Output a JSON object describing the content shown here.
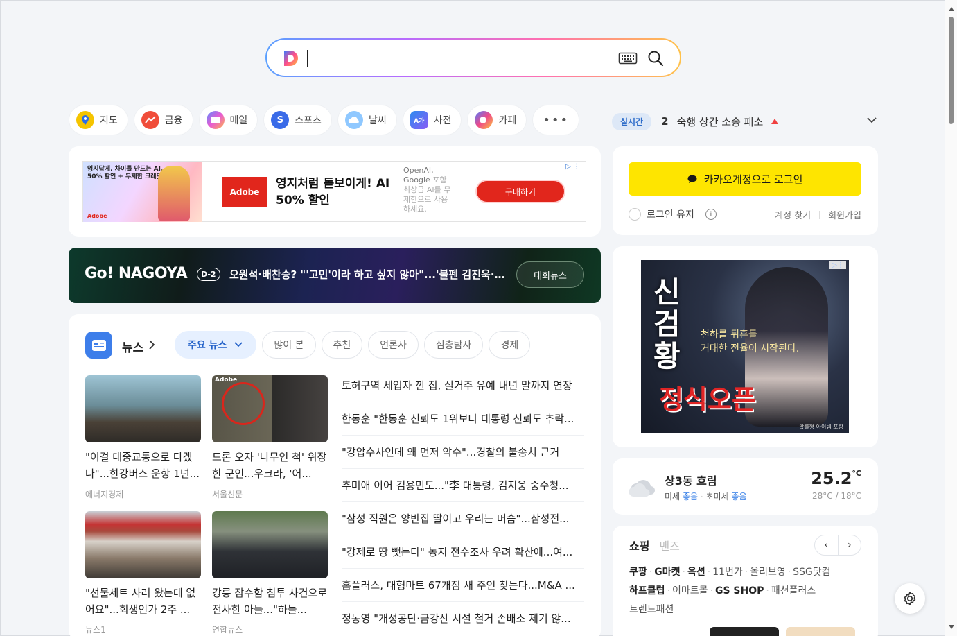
{
  "search": {
    "placeholder": ""
  },
  "shortcuts": [
    {
      "label": "지도",
      "icon": "map-pin-icon",
      "color": "#f5c400"
    },
    {
      "label": "금융",
      "icon": "finance-chart-icon",
      "color": "#f04d3a"
    },
    {
      "label": "메일",
      "icon": "mail-icon",
      "color": "#8a5cf5"
    },
    {
      "label": "스포츠",
      "icon": "sports-icon",
      "color": "#3a6be8"
    },
    {
      "label": "날씨",
      "icon": "weather-icon",
      "color": "#3aa0f0"
    },
    {
      "label": "사전",
      "icon": "dictionary-icon",
      "color": "#2d8bf0"
    },
    {
      "label": "카페",
      "icon": "cafe-icon",
      "color": "#ee4a8a"
    }
  ],
  "more_label": "•••",
  "realtime": {
    "tag": "실시간",
    "rank": "2",
    "keyword": "숙행 상간 소송 패소"
  },
  "ad_top": {
    "thumb_text": "영지답게. 차이를 만드는 AI. 50% 할인 + 무제한 크레딧!",
    "thumb_brand": "Adobe",
    "logo": "Adobe",
    "headline": "영지처럼 돋보이게! AI 50% 할인",
    "sub1": "OpenAI, Google",
    "sub2": "포함",
    "sub3": "최상급 AI를 무제한으로 사용하세요.",
    "button": "구매하기",
    "ad_mark": "▷ ⋮"
  },
  "banner": {
    "brand": "Go! NAGOYA",
    "dday": "D-2",
    "headline": "오원석·배찬승? \"'고민'이라 하고 싶지 않아\"...'불펜 김진욱·1...",
    "button": "대회뉴스"
  },
  "news": {
    "title": "뉴스",
    "tabs": [
      "주요 뉴스",
      "많이 본",
      "추천",
      "언론사",
      "심층탐사",
      "경제"
    ],
    "cards": [
      {
        "text": "\"이걸 대중교통으로 타겠나\"...한강버스 운항 1년...",
        "source": "에너지경제"
      },
      {
        "text": "드론 오자 '나무인 척' 위장한 군인...우크라, '어...",
        "source": "서울신문"
      },
      {
        "text": "\"선물세트 사러 왔는데 없어요\"...회생인가 2주 ...",
        "source": "뉴스1"
      },
      {
        "text": "강릉 잠수함 침투 사건으로 전사한 아들...\"하늘...",
        "source": "연합뉴스"
      }
    ],
    "thumb_badge": "Adobe",
    "headlines": [
      "토허구역 세입자 낀 집, 실거주 유예 내년 말까지 연장",
      "한동훈 \"한동훈 신뢰도 1위보다 대통령 신뢰도 추락...",
      "\"강압수사인데 왜 먼저 악수\"...경찰의 불송치 근거",
      "추미애 이어 김용민도...\"李 대통령, 김지웅 중수청...",
      "\"삼성 직원은 양반집 딸이고 우리는 머슴\"...삼성전...",
      "\"강제로 땅 뺏는다\" 농지 전수조사 우려 확산에...여...",
      "홈플러스, 대형마트 67개점 새 주인 찾는다...M&A ...",
      "정동영 \"개성공단·금강산 시설 철거 손배소 제기 않..."
    ]
  },
  "login": {
    "kakao_button": "카카오계정으로 로그인",
    "keep": "로그인 유지",
    "info": "i",
    "find": "계정 찾기",
    "signup": "회원가입"
  },
  "game_ad": {
    "title": "신검황",
    "tagline1": "천하를 뒤흔들",
    "tagline2": "거대한 전율이 시작된다.",
    "open": "정식오픈",
    "small": "확률형 아이템 포함",
    "mark": "▷⋮"
  },
  "weather": {
    "location": "상3동 흐림",
    "fine_dust_label": "미세",
    "fine_dust": "좋음",
    "ultra_dust_label": "초미세",
    "ultra_dust": "좋음",
    "temp": "25.2",
    "unit": "°C",
    "range": "28°C / 18°C"
  },
  "shop": {
    "tab_on": "쇼핑",
    "tab_off": "맨즈",
    "prev": "‹",
    "next": "›",
    "row1": [
      "쿠팡",
      "G마켓",
      "옥션",
      "11번가",
      "올리브영",
      "SSG닷컴"
    ],
    "row2": [
      "하프클럽",
      "이마트몰",
      "GS SHOP",
      "패션플러스"
    ],
    "row3": [
      "트렌드패션"
    ]
  }
}
